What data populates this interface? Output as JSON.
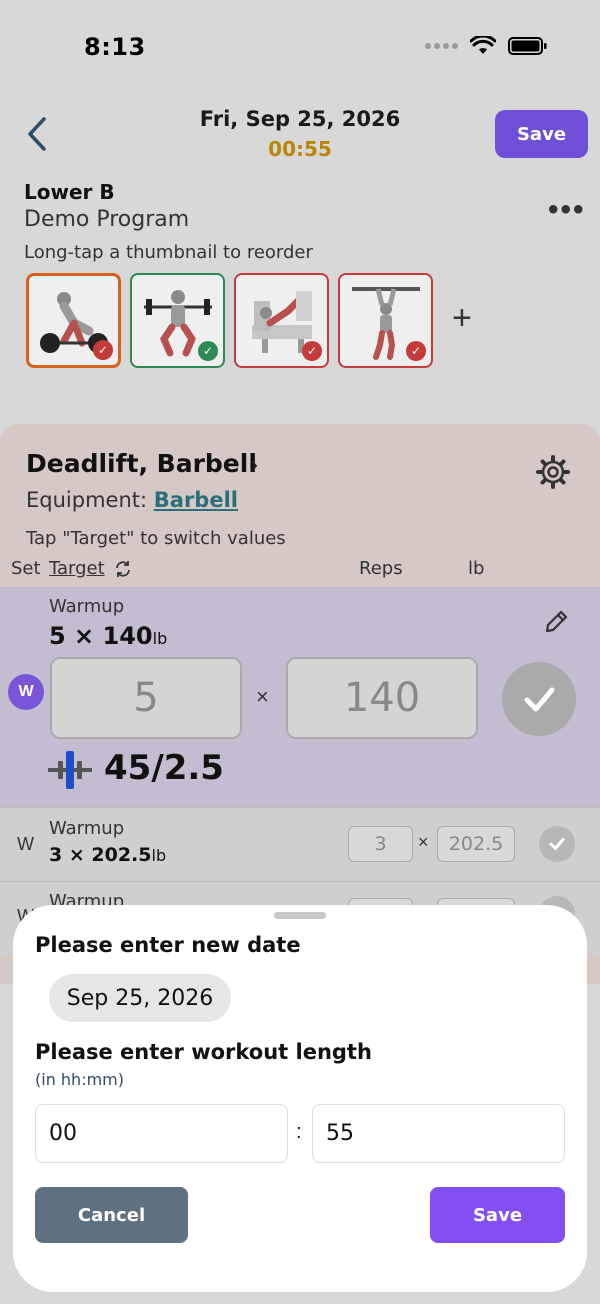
{
  "status_bar": {
    "time": "8:13"
  },
  "header": {
    "date": "Fri, Sep 25, 2026",
    "timer": "00:55",
    "save_label": "Save"
  },
  "workout": {
    "name": "Lower B",
    "program": "Demo Program",
    "reorder_hint": "Long-tap a thumbnail to reorder",
    "thumbnails": [
      {
        "exercise": "deadlift",
        "status": "current"
      },
      {
        "exercise": "squat",
        "status": "complete"
      },
      {
        "exercise": "leg-press",
        "status": "incomplete"
      },
      {
        "exercise": "hanging-leg-raise",
        "status": "incomplete"
      }
    ]
  },
  "exercise": {
    "title": "Deadlift, Barbell",
    "equipment_label": "Equipment:",
    "equipment_value": "Barbell",
    "target_hint": "Tap \"Target\" to switch values",
    "col_set": "Set",
    "col_target": "Target",
    "col_reps": "Reps",
    "col_unit": "lb"
  },
  "sets": [
    {
      "marker": "W",
      "label": "Warmup",
      "reps": "5",
      "weight": "140",
      "unit": "lb",
      "reps_input": "5",
      "weight_input": "140",
      "plates": "45/2.5"
    },
    {
      "marker": "W",
      "label": "Warmup",
      "reps": "3",
      "weight": "202.5",
      "unit": "lb",
      "reps_input": "3",
      "weight_input": "202.5"
    },
    {
      "marker": "W",
      "label": "Warmup"
    }
  ],
  "sheet": {
    "date_title": "Please enter new date",
    "date_value": "Sep 25, 2026",
    "length_title": "Please enter workout length",
    "length_sub": "(in hh:mm)",
    "hours": "00",
    "minutes": "55",
    "separator": ":",
    "cancel_label": "Cancel",
    "save_label": "Save"
  },
  "colors": {
    "accent": "#6e4fd6",
    "timer": "#b8860b",
    "complete": "#2d8a54",
    "incomplete": "#c53a3a",
    "cancel": "#5f7080"
  }
}
